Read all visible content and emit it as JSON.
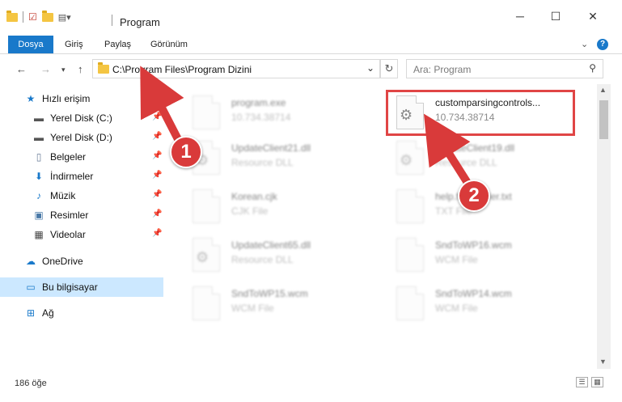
{
  "window": {
    "title": "Program"
  },
  "ribbon": {
    "tabs": [
      "Dosya",
      "Giriş",
      "Paylaş",
      "Görünüm"
    ]
  },
  "address": {
    "path": "C:\\Program Files\\Program Dizini"
  },
  "search": {
    "placeholder": "Ara: Program"
  },
  "sidebar": {
    "quick_access": "Hızlı erişim",
    "items": [
      "Yerel Disk (C:)",
      "Yerel Disk (D:)",
      "Belgeler",
      "İndirmeler",
      "Müzik",
      "Resimler",
      "Videolar"
    ],
    "onedrive": "OneDrive",
    "this_pc": "Bu bilgisayar",
    "network": "Ağ"
  },
  "files": [
    {
      "name": "program.exe",
      "sub": "10.734.38714"
    },
    {
      "name": "customparsingcontrols...",
      "sub": "10.734.38714"
    },
    {
      "name": "UpdateClient21.dll",
      "sub": "Resource DLL"
    },
    {
      "name": "UpdateClient19.dll",
      "sub": "Resource DLL"
    },
    {
      "name": "Korean.cjk",
      "sub": "CJK File"
    },
    {
      "name": "help.file.reader.txt",
      "sub": "TXT File"
    },
    {
      "name": "UpdateClient65.dll",
      "sub": "Resource DLL"
    },
    {
      "name": "SndToWP16.wcm",
      "sub": "WCM File"
    },
    {
      "name": "SndToWP15.wcm",
      "sub": "WCM File"
    },
    {
      "name": "SndToWP14.wcm",
      "sub": "WCM File"
    }
  ],
  "status": {
    "count": "186 öğe"
  },
  "callouts": [
    "1",
    "2"
  ],
  "colors": {
    "accent": "#1979ca",
    "highlight": "#e04545",
    "selected": "#cce8ff"
  }
}
